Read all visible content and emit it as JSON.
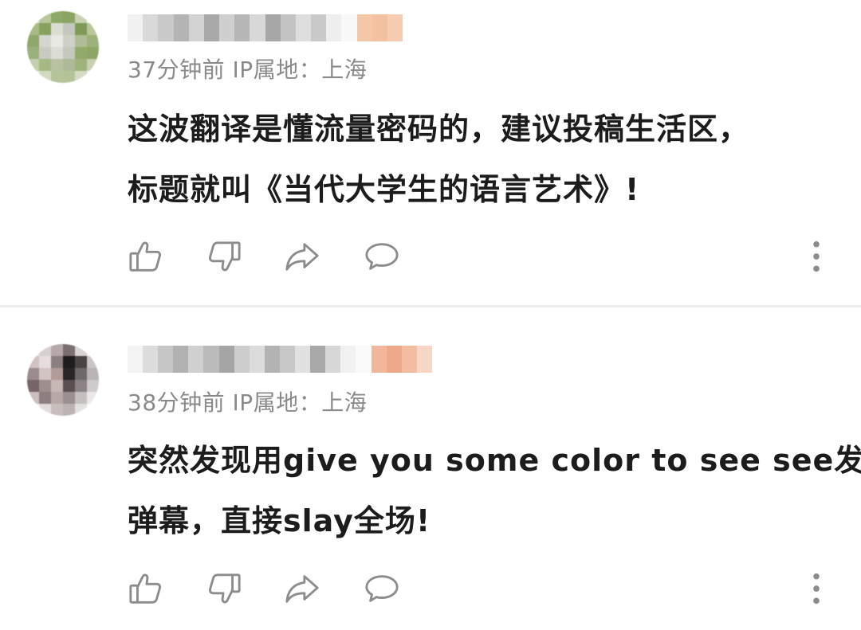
{
  "comments": [
    {
      "time": "37分钟前",
      "ip_location": "IP属地：上海",
      "text_lines": [
        "这波翻译是懂流量密码的，建议投稿生活区，",
        "标题就叫《当代大学生的语言艺术》!"
      ],
      "actions": {
        "like_icon": "thumbs-up-icon",
        "dislike_icon": "thumbs-down-icon",
        "share_icon": "share-icon",
        "reply_icon": "comment-icon",
        "more_icon": "more-vertical-icon"
      }
    },
    {
      "time": "38分钟前",
      "ip_location": "IP属地：上海",
      "text_lines": [
        "突然发现用give you some color to see see发",
        "弹幕，直接slay全场!"
      ],
      "actions": {
        "like_icon": "thumbs-up-icon",
        "dislike_icon": "thumbs-down-icon",
        "share_icon": "share-icon",
        "reply_icon": "comment-icon",
        "more_icon": "more-vertical-icon"
      }
    }
  ],
  "colors": {
    "meta_text": "#8a8a8a",
    "body_text": "#1c1c1c",
    "icon_stroke": "#8c8c8c",
    "divider": "#ececec"
  }
}
